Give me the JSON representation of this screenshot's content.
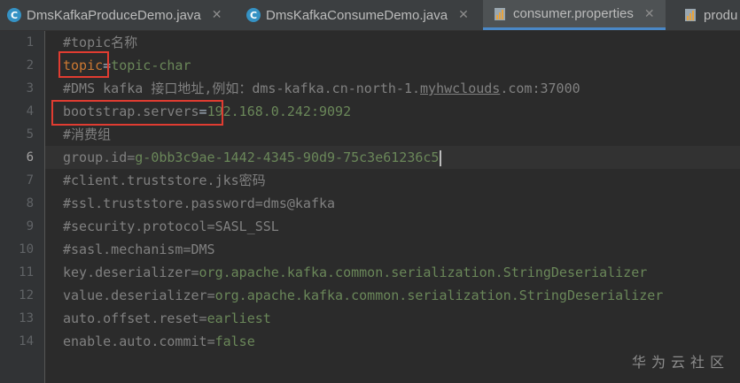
{
  "tabs": [
    {
      "label": "DmsKafkaProduceDemo.java",
      "icon": "java-class-icon",
      "active": false
    },
    {
      "label": "DmsKafkaConsumeDemo.java",
      "icon": "java-class-icon",
      "active": false
    },
    {
      "label": "consumer.properties",
      "icon": "properties-file-icon",
      "active": true
    },
    {
      "label": "produ",
      "icon": "properties-file-icon",
      "active": false
    }
  ],
  "line_numbers": [
    "1",
    "2",
    "3",
    "4",
    "5",
    "6",
    "7",
    "8",
    "9",
    "10",
    "11",
    "12",
    "13",
    "14"
  ],
  "lines": {
    "l1": "#topic名称",
    "l2_key": "topic",
    "l2_eq": "=",
    "l2_val": "topic-char",
    "l3_a": "#DMS kafka 接口地址,例如：dms-kafka.cn-north-1.",
    "l3_b": "myhwclouds",
    "l3_c": ".com:37000",
    "l4_key": "bootstrap.servers",
    "l4_eq": "=",
    "l4_val": "192.168.0.242:9092",
    "l5": "#消费组",
    "l6_key": "group.id",
    "l6_eq": "=",
    "l6_val": "g-0bb3c9ae-1442-4345-90d9-75c3e61236c5",
    "l7": "#client.truststore.jks密码",
    "l8": "#ssl.truststore.password=dms@kafka",
    "l9": "#security.protocol=SASL_SSL",
    "l10": "#sasl.mechanism=DMS",
    "l11_key": "key.deserializer",
    "l11_eq": "=",
    "l11_val": "org.apache.kafka.common.serialization.StringDeserializer",
    "l12_key": "value.deserializer",
    "l12_eq": "=",
    "l12_val": "org.apache.kafka.common.serialization.StringDeserializer",
    "l13_key": "auto.offset.reset",
    "l13_eq": "=",
    "l13_val": "earliest",
    "l14_key": "enable.auto.commit",
    "l14_eq": "=",
    "l14_val": "false"
  },
  "watermark": "华为云社区",
  "colors": {
    "highlight_box": "#e03c31",
    "active_tab_underline": "#4a88c7"
  }
}
